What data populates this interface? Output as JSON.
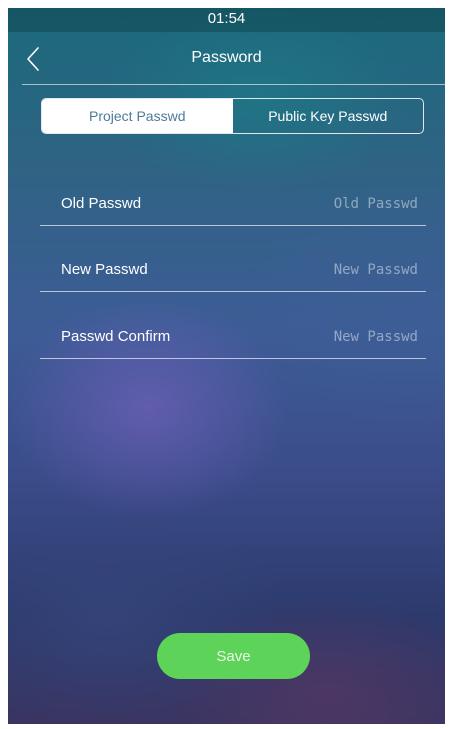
{
  "status_bar": {
    "time": "01:54"
  },
  "header": {
    "title": "Password",
    "back_icon": "chevron-left-icon"
  },
  "tabs": [
    {
      "label": "Project Passwd",
      "active": true
    },
    {
      "label": "Public Key Passwd",
      "active": false
    }
  ],
  "form": {
    "rows": [
      {
        "label": "Old Passwd",
        "value": "",
        "placeholder": "Old Passwd"
      },
      {
        "label": "New Passwd",
        "value": "",
        "placeholder": "New Passwd"
      },
      {
        "label": "Passwd Confirm",
        "value": "",
        "placeholder": "New Passwd"
      }
    ]
  },
  "actions": {
    "save_label": "Save"
  },
  "colors": {
    "active_tab_bg": "#ffffff",
    "active_tab_text": "#4d7b9a",
    "save_button": "#5ed35a"
  }
}
